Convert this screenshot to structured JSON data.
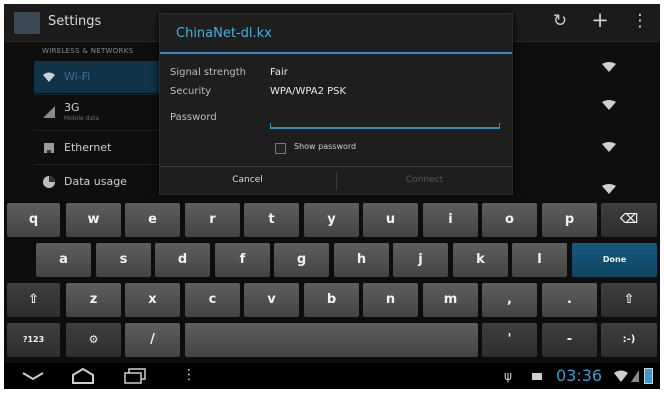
{
  "action_bar": {
    "title": "Settings",
    "icons": [
      "wifi-scan-icon",
      "add-network-icon",
      "overflow-menu-icon"
    ]
  },
  "settings_list": {
    "section_label": "WIRELESS & NETWORKS",
    "items": [
      {
        "label": "Wi-Fi",
        "icon": "wifi-icon",
        "active": true
      },
      {
        "label": "3G",
        "sub": "Mobile data",
        "icon": "signal-icon"
      },
      {
        "label": "Ethernet",
        "icon": "ethernet-icon"
      },
      {
        "label": "Data usage",
        "icon": "data-usage-icon"
      }
    ]
  },
  "dialog": {
    "title": "ChinaNet-dl.kx",
    "signal_label": "Signal strength",
    "signal_value": "Fair",
    "security_label": "Security",
    "security_value": "WPA/WPA2 PSK",
    "password_label": "Password",
    "password_value": "",
    "show_password_label": "Show password",
    "cancel_label": "Cancel",
    "connect_label": "Connect"
  },
  "keyboard": {
    "row1": [
      "q",
      "w",
      "e",
      "r",
      "t",
      "y",
      "u",
      "i",
      "o",
      "p"
    ],
    "row2": [
      "a",
      "s",
      "d",
      "f",
      "g",
      "h",
      "j",
      "k",
      "l"
    ],
    "row3": [
      "z",
      "x",
      "c",
      "v",
      "b",
      "n",
      "m",
      ",",
      "."
    ],
    "done_label": "Done",
    "numbers_label": "?123",
    "slash_label": "/",
    "shift_icon": "⇧",
    "backspace_icon": "⌫",
    "settings_icon": "⚙",
    "quote_label": "'",
    "dash_label": "-",
    "smiley_label": ":-)"
  },
  "nav_bar": {
    "time": "03:36",
    "icons": [
      "back-icon",
      "home-icon",
      "recent-apps-icon",
      "menu-icon",
      "usb-icon",
      "notification-icon",
      "wifi-status-icon",
      "battery-icon"
    ]
  },
  "colors": {
    "accent": "#2e8fc0",
    "clock": "#2f9fd6",
    "done_key": "#165a7d"
  }
}
